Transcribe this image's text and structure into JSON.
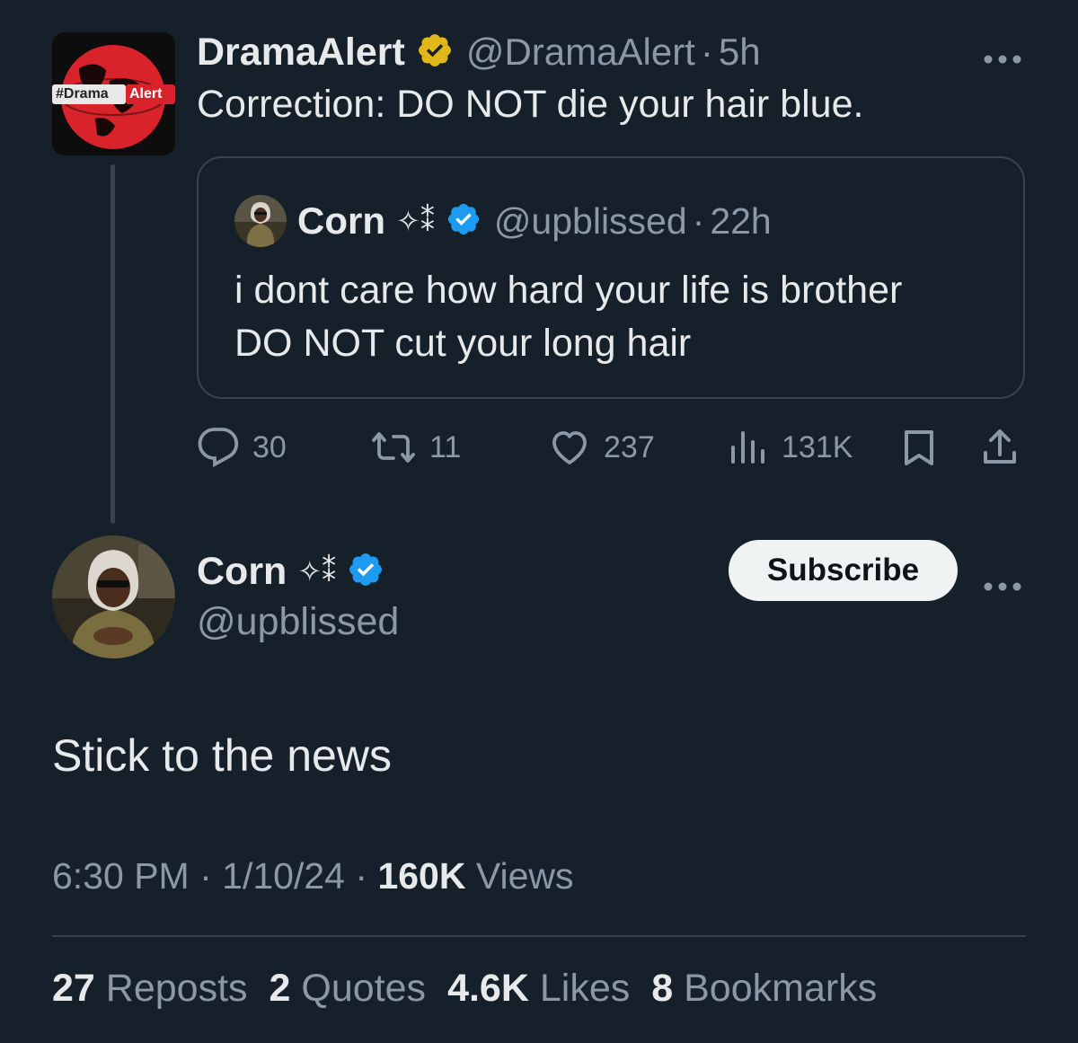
{
  "parent_tweet": {
    "avatar_text_left": "#Drama",
    "avatar_text_right": "Alert",
    "name": "DramaAlert",
    "handle": "@DramaAlert",
    "separator": "·",
    "time": "5h",
    "text": "Correction: DO NOT die your hair blue.",
    "badge_color": "#e2b719",
    "more_icon": "more-horizontal-icon"
  },
  "quoted_tweet": {
    "name": "Corn",
    "symbols": "✧⁑",
    "handle": "@upblissed",
    "separator": "·",
    "time": "22h",
    "text_line1": "i dont care how hard your life is brother",
    "text_line2": "DO NOT cut your long hair",
    "badge_color": "#1d9bf0"
  },
  "actions": {
    "replies": "30",
    "reposts": "11",
    "likes": "237",
    "views": "131K"
  },
  "main_tweet": {
    "name": "Corn",
    "symbols": "✧⁑",
    "handle": "@upblissed",
    "subscribe_label": "Subscribe",
    "text": "Stick to the news",
    "time": "6:30 PM",
    "separator": "·",
    "date": "1/10/24",
    "views_count": "160K",
    "views_label": "Views"
  },
  "stats": {
    "reposts_count": "27",
    "reposts_label": "Reposts",
    "quotes_count": "2",
    "quotes_label": "Quotes",
    "likes_count": "4.6K",
    "likes_label": "Likes",
    "bookmarks_count": "8",
    "bookmarks_label": "Bookmarks"
  },
  "colors": {
    "background": "#15202b",
    "text_primary": "#e7e9ea",
    "text_secondary": "#8b98a5",
    "border": "#38444d",
    "verified_blue": "#1d9bf0",
    "verified_gold": "#e2b719"
  }
}
